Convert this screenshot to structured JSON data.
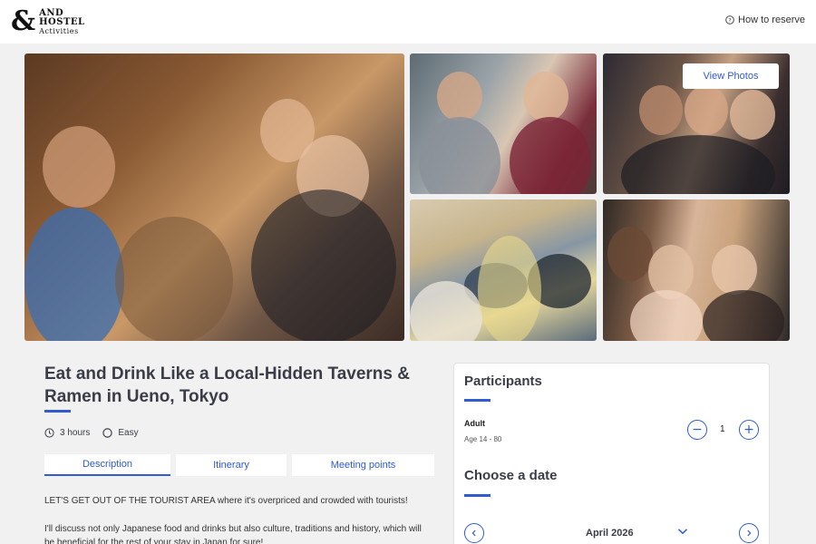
{
  "header": {
    "logo": {
      "amp": "&",
      "line1": "AND",
      "line2": "HOSTEL",
      "line3": "Activities"
    },
    "how_to_reserve": "How to reserve",
    "how_to_icon": "question-circle-icon"
  },
  "gallery": {
    "view_photos": "View Photos"
  },
  "tour": {
    "title": "Eat and Drink Like a Local-Hidden Taverns & Ramen in Ueno, Tokyo",
    "duration": "3 hours",
    "duration_icon": "clock-icon",
    "difficulty": "Easy",
    "difficulty_icon": "circle-icon",
    "tabs": [
      {
        "label": "Description",
        "active": true
      },
      {
        "label": "Itinerary",
        "active": false
      },
      {
        "label": "Meeting points",
        "active": false
      }
    ],
    "description": [
      "LET'S GET OUT OF THE TOURIST AREA where it's overpriced and crowded with tourists!",
      "I'll discuss not only Japanese food and drinks but also culture, traditions and history, which will be beneficial for the rest of your stay in Japan for sure!"
    ]
  },
  "booking": {
    "participants_title": "Participants",
    "adult_label": "Adult",
    "adult_age": "Age 14 - 80",
    "quantity": "1",
    "minus": "−",
    "plus": "+",
    "date_title": "Choose a date",
    "month": "April 2026"
  },
  "colors": {
    "accent": "#2f5bd3",
    "background": "#f1f1f1",
    "text": "#3a3d47"
  }
}
